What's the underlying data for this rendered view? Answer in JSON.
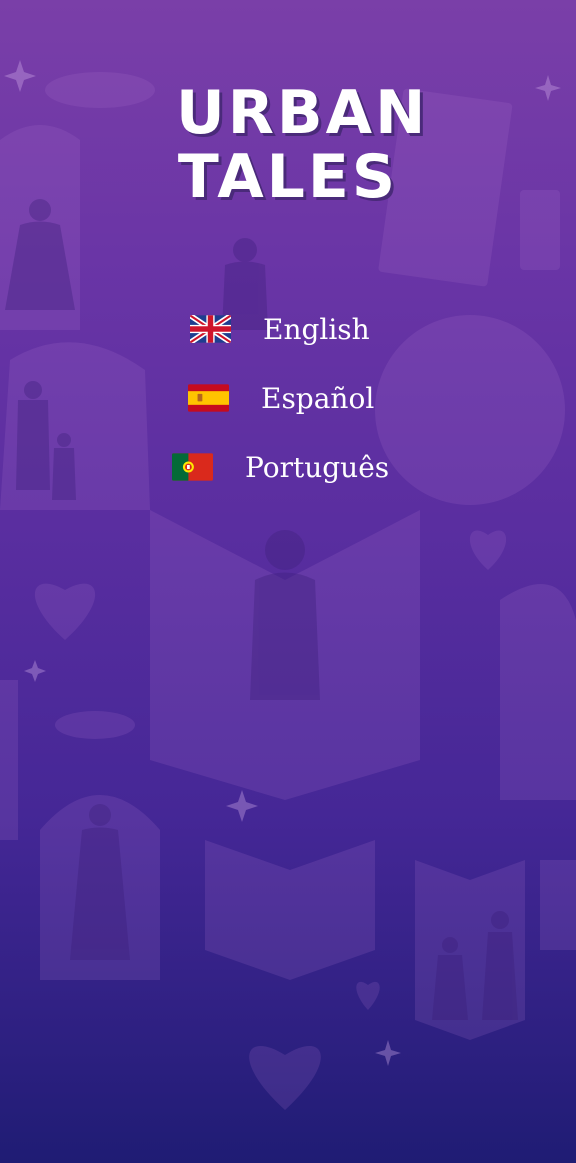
{
  "app": {
    "logo_line1": "URBAN",
    "logo_line2": "TALES"
  },
  "languages": [
    {
      "label": "English",
      "flag": "uk-flag-icon"
    },
    {
      "label": "Español",
      "flag": "spain-flag-icon"
    },
    {
      "label": "Português",
      "flag": "portugal-flag-icon"
    }
  ],
  "colors": {
    "background_top": "#7a3fa8",
    "background_bottom": "#1f1c74",
    "text": "#ffffff"
  }
}
